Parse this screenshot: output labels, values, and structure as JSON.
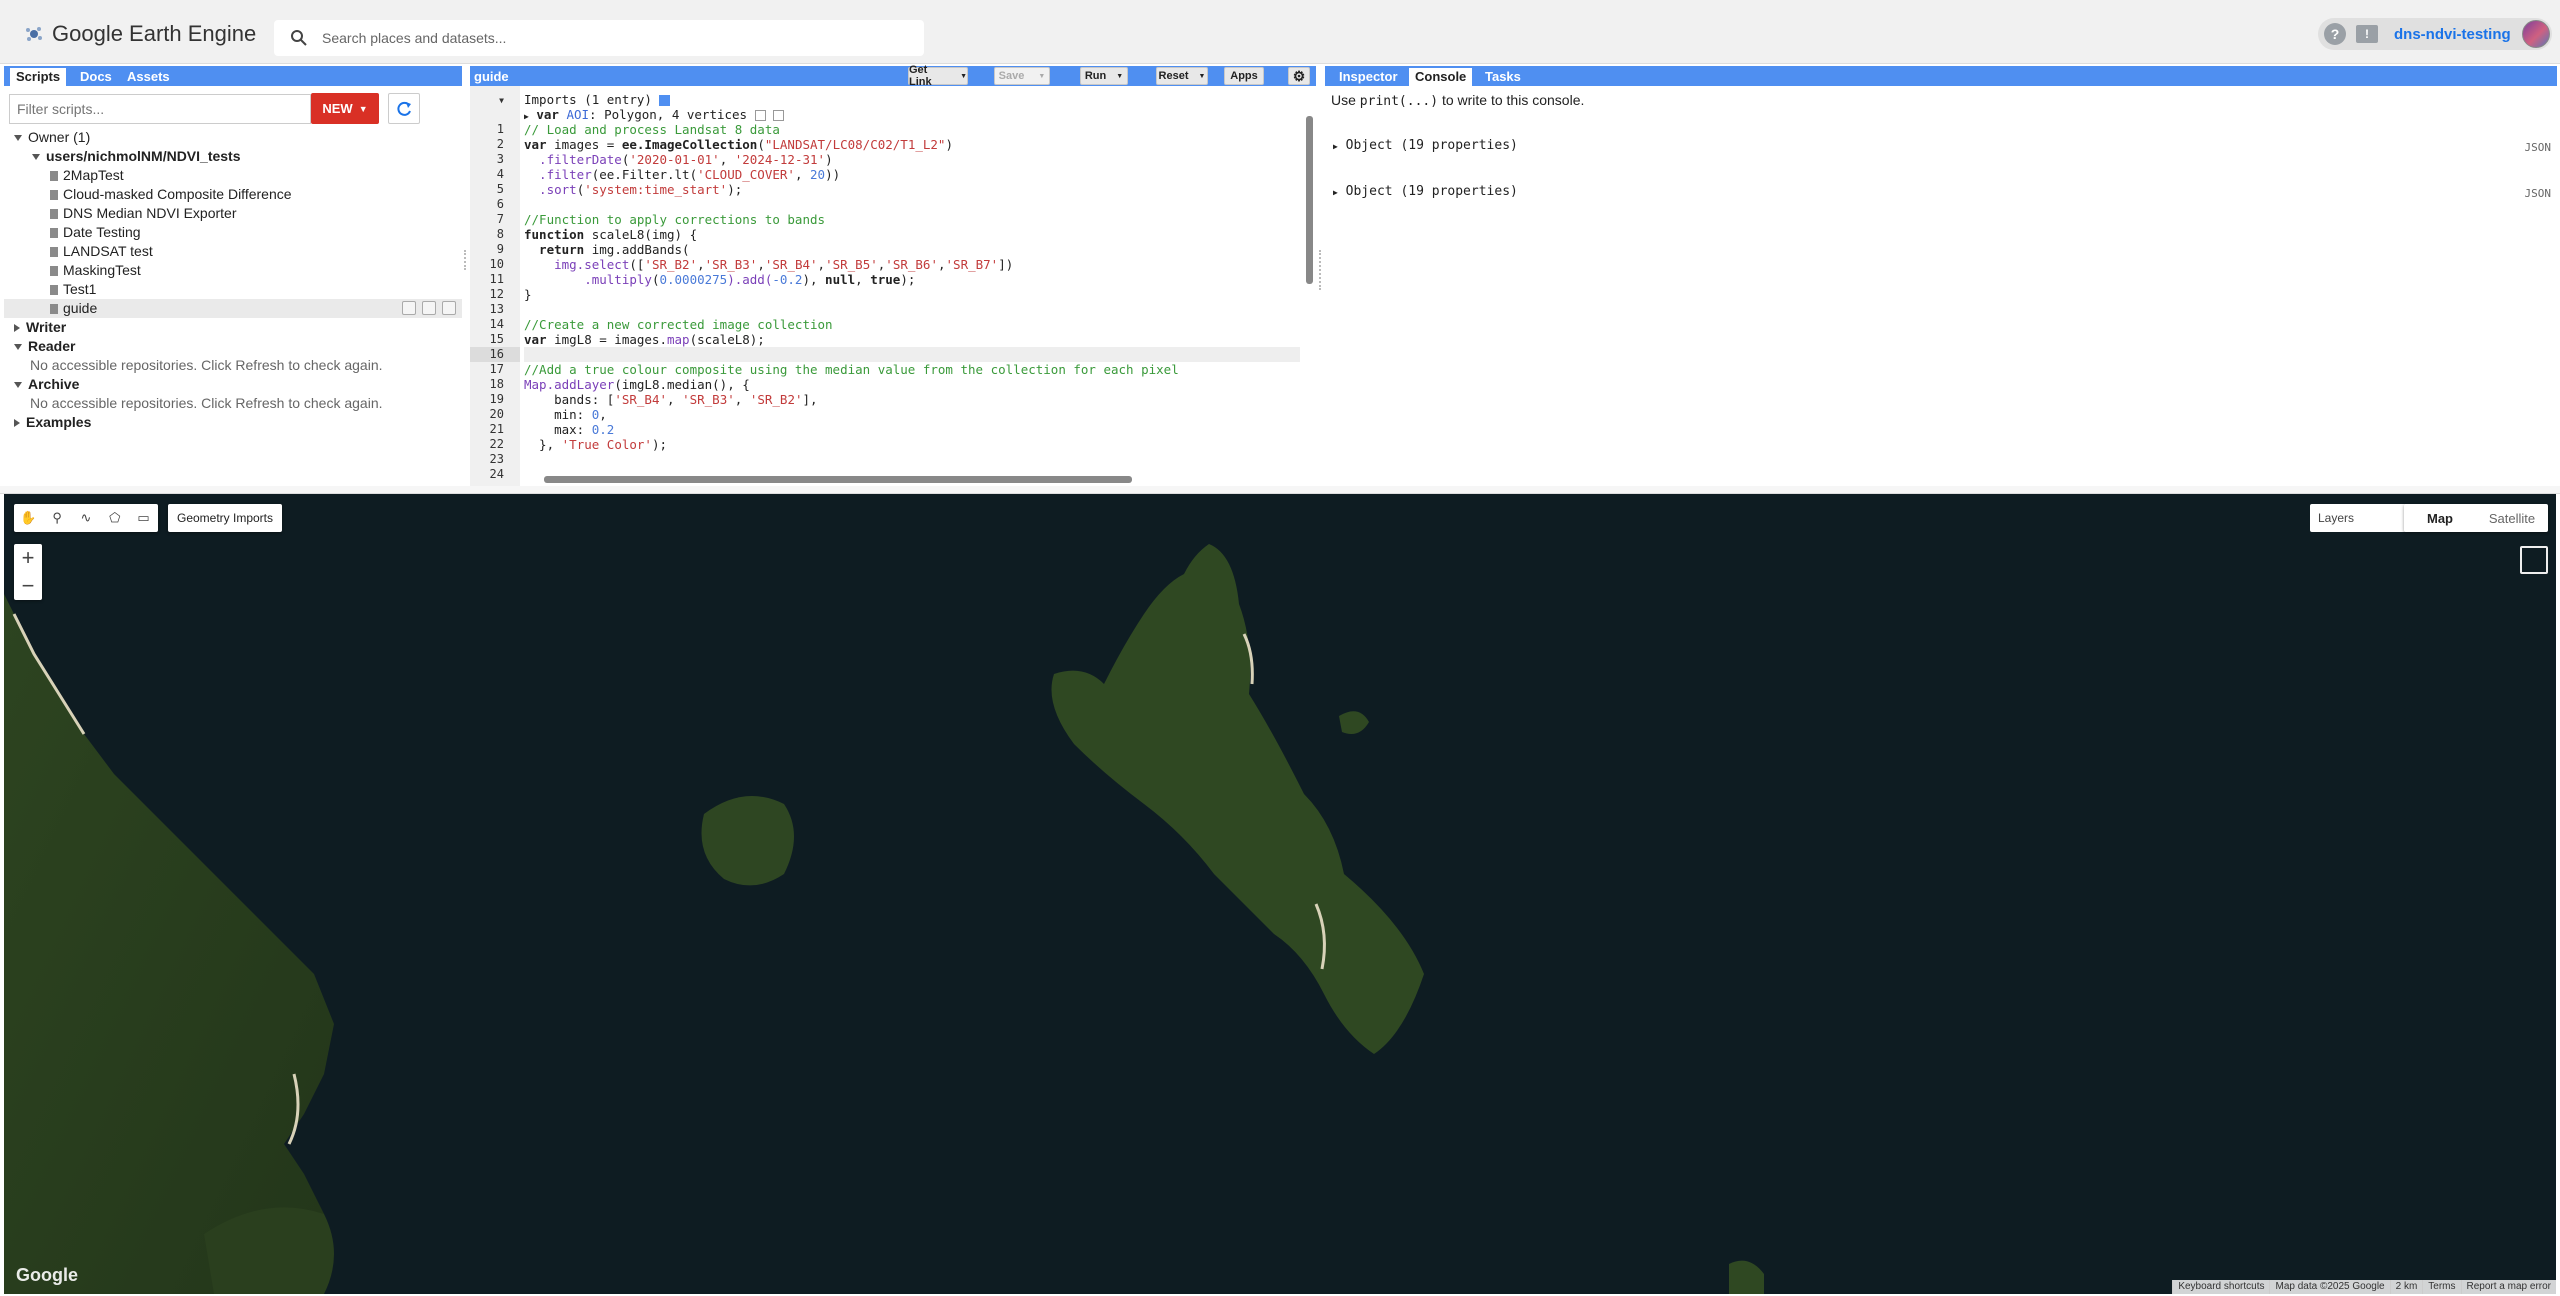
{
  "app": {
    "title": "Google Earth Engine"
  },
  "search": {
    "placeholder": "Search places and datasets..."
  },
  "user": {
    "help": "?",
    "feedback": "!",
    "name": "dns-ndvi-testing"
  },
  "left": {
    "tabs": [
      "Scripts",
      "Docs",
      "Assets"
    ],
    "filter_placeholder": "Filter scripts...",
    "new_label": "NEW",
    "owner": "Owner (1)",
    "repo": "users/nichmolNM/NDVI_tests",
    "files": [
      "2MapTest",
      "Cloud-masked Composite Difference",
      "DNS Median NDVI Exporter",
      "Date Testing",
      "LANDSAT test",
      "MaskingTest",
      "Test1",
      "guide"
    ],
    "writer": "Writer",
    "reader": "Reader",
    "reader_msg": "No accessible repositories. Click Refresh to check again.",
    "archive": "Archive",
    "archive_msg": "No accessible repositories. Click Refresh to check again.",
    "examples": "Examples"
  },
  "editor": {
    "title": "guide",
    "buttons": {
      "getlink": "Get Link",
      "save": "Save",
      "run": "Run",
      "reset": "Reset",
      "apps": "Apps"
    },
    "imports_header": "Imports (1 entry)",
    "imports_kw": "var",
    "imports_name": "AOI",
    "imports_desc": ": Polygon, 4 vertices",
    "line_numbers": [
      "1",
      "2",
      "3",
      "4",
      "5",
      "6",
      "7",
      "8",
      "9",
      "10",
      "11",
      "12",
      "13",
      "14",
      "15",
      "16",
      "17",
      "18",
      "19",
      "20",
      "21",
      "22",
      "23",
      "24"
    ],
    "code": {
      "l1": "// Load and process Landsat 8 data",
      "l2a": "var",
      "l2b": " images = ",
      "l2c": "ee.ImageCollection",
      "l2d": "(",
      "l2e": "\"LANDSAT/LC08/C02/T1_L2\"",
      "l2f": ")",
      "l3a": "  .filterDate",
      "l3b": "(",
      "l3c": "'2020-01-01'",
      "l3d": ", ",
      "l3e": "'2024-12-31'",
      "l3f": ")",
      "l4a": "  .filter",
      "l4b": "(ee.Filter.lt(",
      "l4c": "'CLOUD_COVER'",
      "l4d": ", ",
      "l4e": "20",
      "l4f": "))",
      "l5a": "  .sort",
      "l5b": "(",
      "l5c": "'system:time_start'",
      "l5d": ");",
      "l7": "//Function to apply corrections to bands",
      "l8a": "function",
      "l8b": " scaleL8(img) {",
      "l9a": "  return",
      "l9b": " img.addBands(",
      "l10a": "    img.select",
      "l10b": "([",
      "l10c": "'SR_B2'",
      "l10d": ",",
      "l10e": "'SR_B3'",
      "l10f": ",",
      "l10g": "'SR_B4'",
      "l10h": ",",
      "l10i": "'SR_B5'",
      "l10j": ",",
      "l10k": "'SR_B6'",
      "l10l": ",",
      "l10m": "'SR_B7'",
      "l10n": "])",
      "l11a": "        .multiply",
      "l11b": "(",
      "l11c": "0.0000275",
      "l11d": ").add(",
      "l11e": "-0.2",
      "l11f": "), ",
      "l11g": "null",
      "l11h": ", ",
      "l11i": "true",
      "l11j": ");",
      "l12": "}",
      "l14": "//Create a new corrected image collection",
      "l15a": "var",
      "l15b": " imgL8 = images.",
      "l15c": "map",
      "l15d": "(scaleL8);",
      "l17": "//Add a true colour composite using the median value from the collection for each pixel",
      "l18a": "Map.addLayer",
      "l18b": "(imgL8.median(), {",
      "l19a": "    bands: [",
      "l19b": "'SR_B4'",
      "l19c": ", ",
      "l19d": "'SR_B3'",
      "l19e": ", ",
      "l19f": "'SR_B2'",
      "l19g": "],",
      "l20a": "    min: ",
      "l20b": "0",
      "l20c": ",",
      "l21a": "    max: ",
      "l21b": "0.2",
      "l22a": "  }, ",
      "l22b": "'True Color'",
      "l22c": ");"
    }
  },
  "right": {
    "tabs": [
      "Inspector",
      "Console",
      "Tasks"
    ],
    "hint_pre": "Use ",
    "hint_code": "print(...)",
    "hint_post": " to write to this console.",
    "objects": [
      "Object (19 properties)",
      "Object (19 properties)"
    ],
    "json_label": "JSON"
  },
  "map": {
    "geometry_imports": "Geometry Imports",
    "zoom_in": "+",
    "zoom_out": "−",
    "layers": "Layers",
    "map_btn": "Map",
    "satellite_btn": "Satellite",
    "google": "Google",
    "footer": [
      "Keyboard shortcuts",
      "Map data ©2025 Google",
      "2 km",
      "Terms",
      "Report a map error"
    ]
  },
  "colors": {
    "accent": "#4f8ff1",
    "new_button": "#d93025",
    "ocean": "#0e1c22",
    "land": "#2f4a22"
  }
}
